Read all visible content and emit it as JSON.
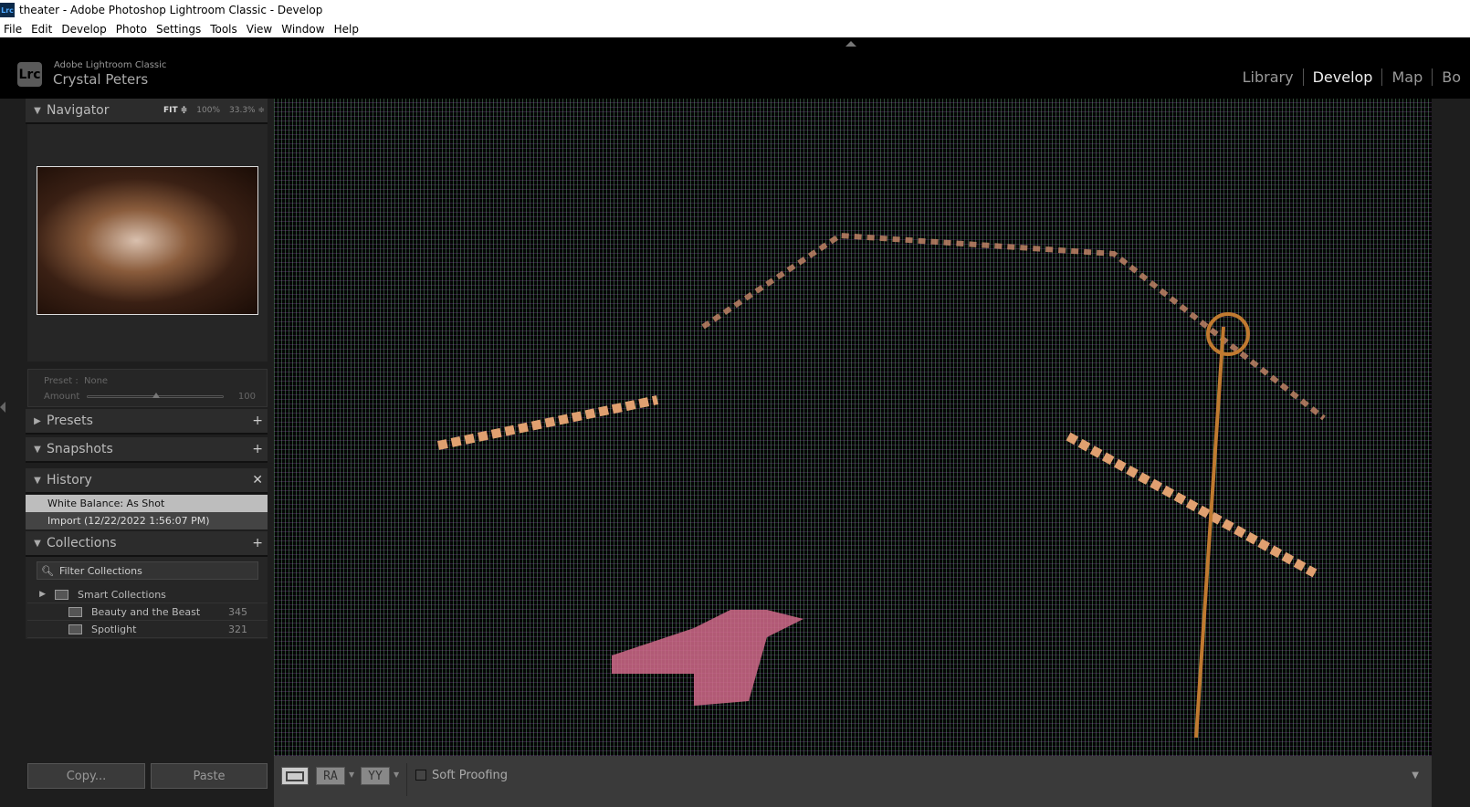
{
  "window": {
    "title": "theater - Adobe Photoshop Lightroom Classic - Develop",
    "app_icon": "Lrc"
  },
  "menu": [
    "File",
    "Edit",
    "Develop",
    "Photo",
    "Settings",
    "Tools",
    "View",
    "Window",
    "Help"
  ],
  "identity": {
    "logo": "Lrc",
    "product": "Adobe Lightroom Classic",
    "user": "Crystal Peters"
  },
  "modules": [
    {
      "label": "Library"
    },
    {
      "label": "Develop",
      "active": true
    },
    {
      "label": "Map"
    },
    {
      "label": "Bo"
    }
  ],
  "navigator": {
    "title": "Navigator",
    "fit": "FIT ≑",
    "z100": "100%",
    "z33": "33.3% ≑"
  },
  "preset": {
    "label": "Preset :",
    "value": "None",
    "amount_label": "Amount",
    "amount": "100",
    "slider_fraction": 0.5
  },
  "panels": {
    "presets": "Presets",
    "snapshots": "Snapshots",
    "history": "History",
    "collections": "Collections"
  },
  "history": [
    "White Balance: As Shot",
    "Import (12/22/2022 1:56:07 PM)"
  ],
  "collections": {
    "filter_placeholder": "Filter Collections",
    "items": [
      {
        "name": "Smart Collections",
        "count": ""
      },
      {
        "name": "Beauty and the Beast",
        "count": "345"
      },
      {
        "name": "Spotlight",
        "count": "321"
      }
    ]
  },
  "buttons": {
    "copy": "Copy...",
    "paste": "Paste"
  },
  "toolbar": {
    "ra": "RA",
    "yy": "YY",
    "soft_proofing": "Soft Proofing"
  }
}
